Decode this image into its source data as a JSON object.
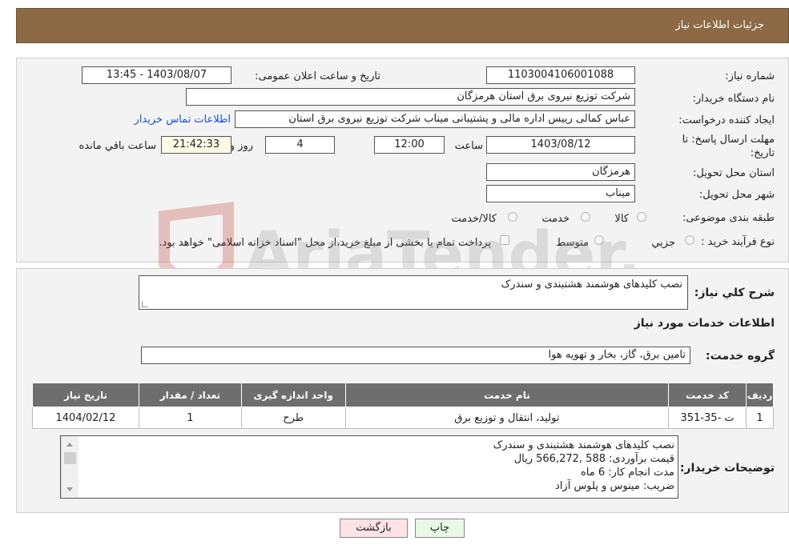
{
  "header": {
    "title": "جزئیات اطلاعات نیاز"
  },
  "form": {
    "need_number_label": "شماره نیاز:",
    "need_number": "1103004106001088",
    "announce_label": "تاریخ و ساعت اعلان عمومی:",
    "announce_value": "1403/08/07 - 13:45",
    "buyer_org_label": "نام دستگاه خریدار:",
    "buyer_org": "شرکت توزیع نیروی برق استان هرمزگان",
    "creator_label": "ایجاد کننده درخواست:",
    "creator": "عباس کمالی رییس اداره مالی و پشتیبانی میناب شرکت توزیع نیروی برق استان",
    "contact_link": "اطلاعات تماس خریدار",
    "deadline_label_1": "مهلت ارسال پاسخ: تا",
    "deadline_label_2": "تاریخ:",
    "deadline_date": "1403/08/12",
    "time_label": "ساعت",
    "deadline_time": "12:00",
    "days_value": "4",
    "days_label": "روز و",
    "remaining_time": "21:42:33",
    "remaining_label": "ساعت باقي مانده",
    "province_label": "استان محل تحویل:",
    "province": "هرمزگان",
    "city_label": "شهر محل تحویل:",
    "city": "میناب",
    "category_label": "طبقه بندی موضوعی:",
    "category_options": [
      "کالا",
      "خدمت",
      "کالا/خدمت"
    ],
    "process_label": "نوع فرآیند خرید :",
    "process_options": [
      "جزیي",
      "متوسط"
    ],
    "payment_note": "پرداخت تمام یا بخشی از مبلغ خرید،از محل \"اسناد خزانه اسلامی\" خواهد بود."
  },
  "summary": {
    "label": "شرح كلي نياز:",
    "value": "نصب کلیدهای هوشمند هشتبندی و سندرک"
  },
  "services_heading": "اطلاعات خدمات مورد نیاز",
  "service_group": {
    "label": "گروه خدمت:",
    "value": "تامین برق، گاز، بخار و تهویه هوا"
  },
  "table": {
    "headers": [
      "ردیف",
      "کد خدمت",
      "نام خدمت",
      "واحد اندازه گیری",
      "تعداد / مقدار",
      "تاریخ نیاز"
    ],
    "rows": [
      [
        "1",
        "ت -35-351",
        "تولید، انتقال و توزیع برق",
        "طرح",
        "1",
        "1404/02/12"
      ]
    ]
  },
  "buyer_notes": {
    "label": "توضیحات خریدار:",
    "lines": [
      "نصب کلیدهای هوشمند هشتبندی و سندرک",
      "قیمت برآوردی:  588 ,566,272 ریال",
      "مدت انجام کار: 6 ماه",
      "ضریب: مینوس و پلوس آزاد"
    ]
  },
  "buttons": {
    "print": "چاپ",
    "back": "بازگشت"
  },
  "watermark": {
    "text": "AriaTender.neT",
    "color": "#c0392b"
  }
}
